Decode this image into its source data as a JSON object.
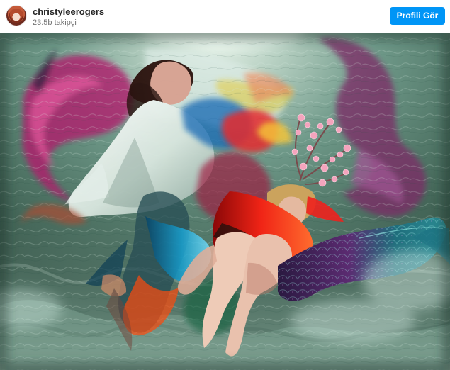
{
  "post": {
    "username": "christyleerogers",
    "followers": "23.5b takipçi",
    "button_label": "Profili Gör"
  },
  "colors": {
    "button": "#0095f6",
    "username": "#262626",
    "followers": "#737373",
    "water": "#5f8676"
  },
  "icons": {
    "avatar": "profile-avatar"
  }
}
